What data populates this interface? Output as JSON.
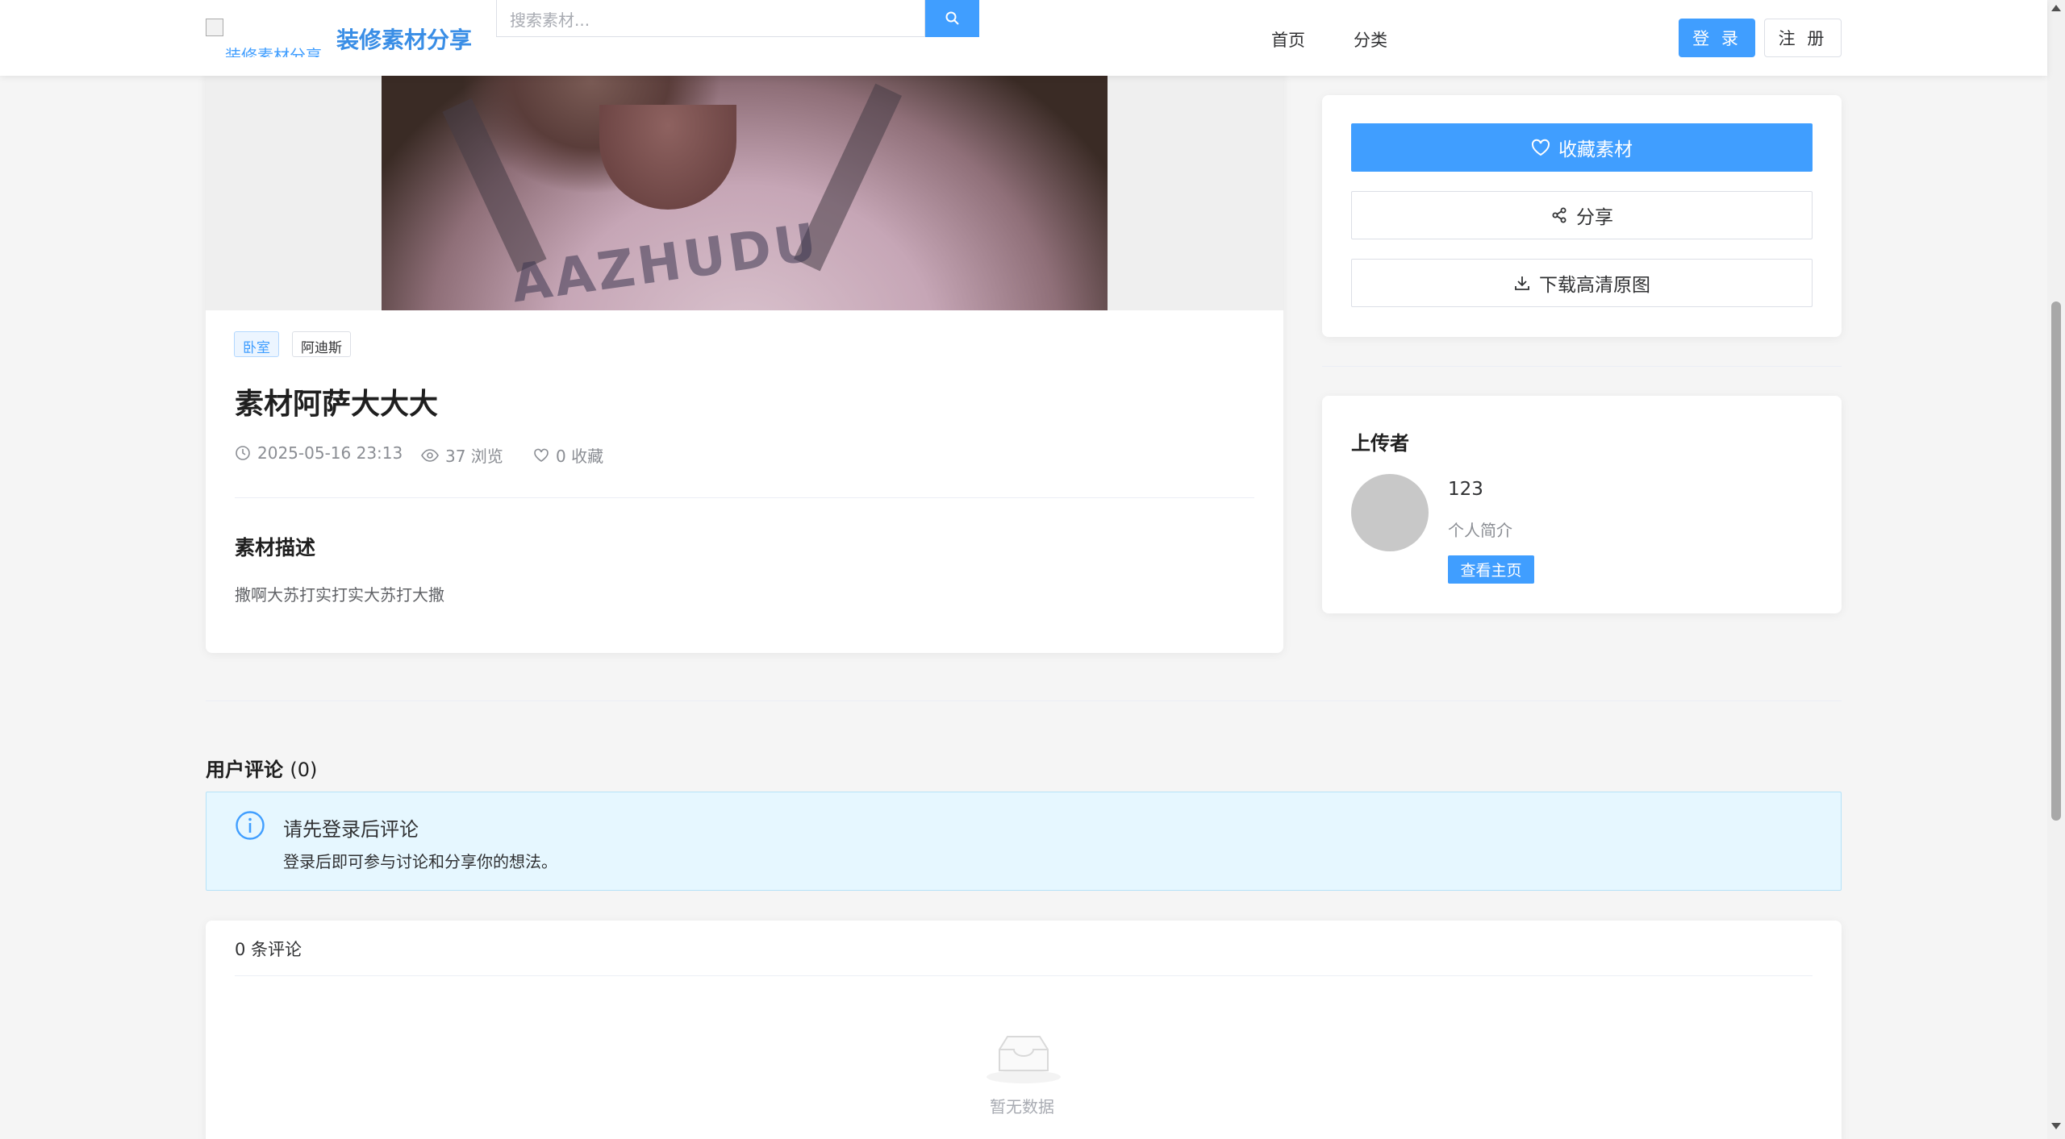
{
  "header": {
    "logo_alt": "装修素材分享",
    "site_name": "装修素材分享",
    "search_placeholder": "搜索素材...",
    "nav": [
      "首页",
      "分类"
    ],
    "login": "登 录",
    "register": "注 册"
  },
  "material": {
    "tags": [
      "卧室",
      "阿迪斯"
    ],
    "title": "素材阿萨大大大",
    "date": "2025-05-16 23:13",
    "views": "37 浏览",
    "favorites": "0 收藏",
    "description_title": "素材描述",
    "description": "撒啊大苏打实打实大苏打大撒",
    "image_text": "AAZHUDU"
  },
  "actions": {
    "favorite": "收藏素材",
    "share": "分享",
    "download": "下载高清原图"
  },
  "uploader": {
    "section_title": "上传者",
    "name": "123",
    "bio": "个人简介",
    "homepage_button": "查看主页"
  },
  "comments": {
    "title": "用户评论",
    "count_paren": "(0)",
    "alert_title": "请先登录后评论",
    "alert_desc": "登录后即可参与讨论和分享你的想法。",
    "list_count": "0 条评论",
    "empty": "暂无数据"
  },
  "colors": {
    "primary": "#409eff",
    "alert_bg": "#e6f7ff"
  }
}
